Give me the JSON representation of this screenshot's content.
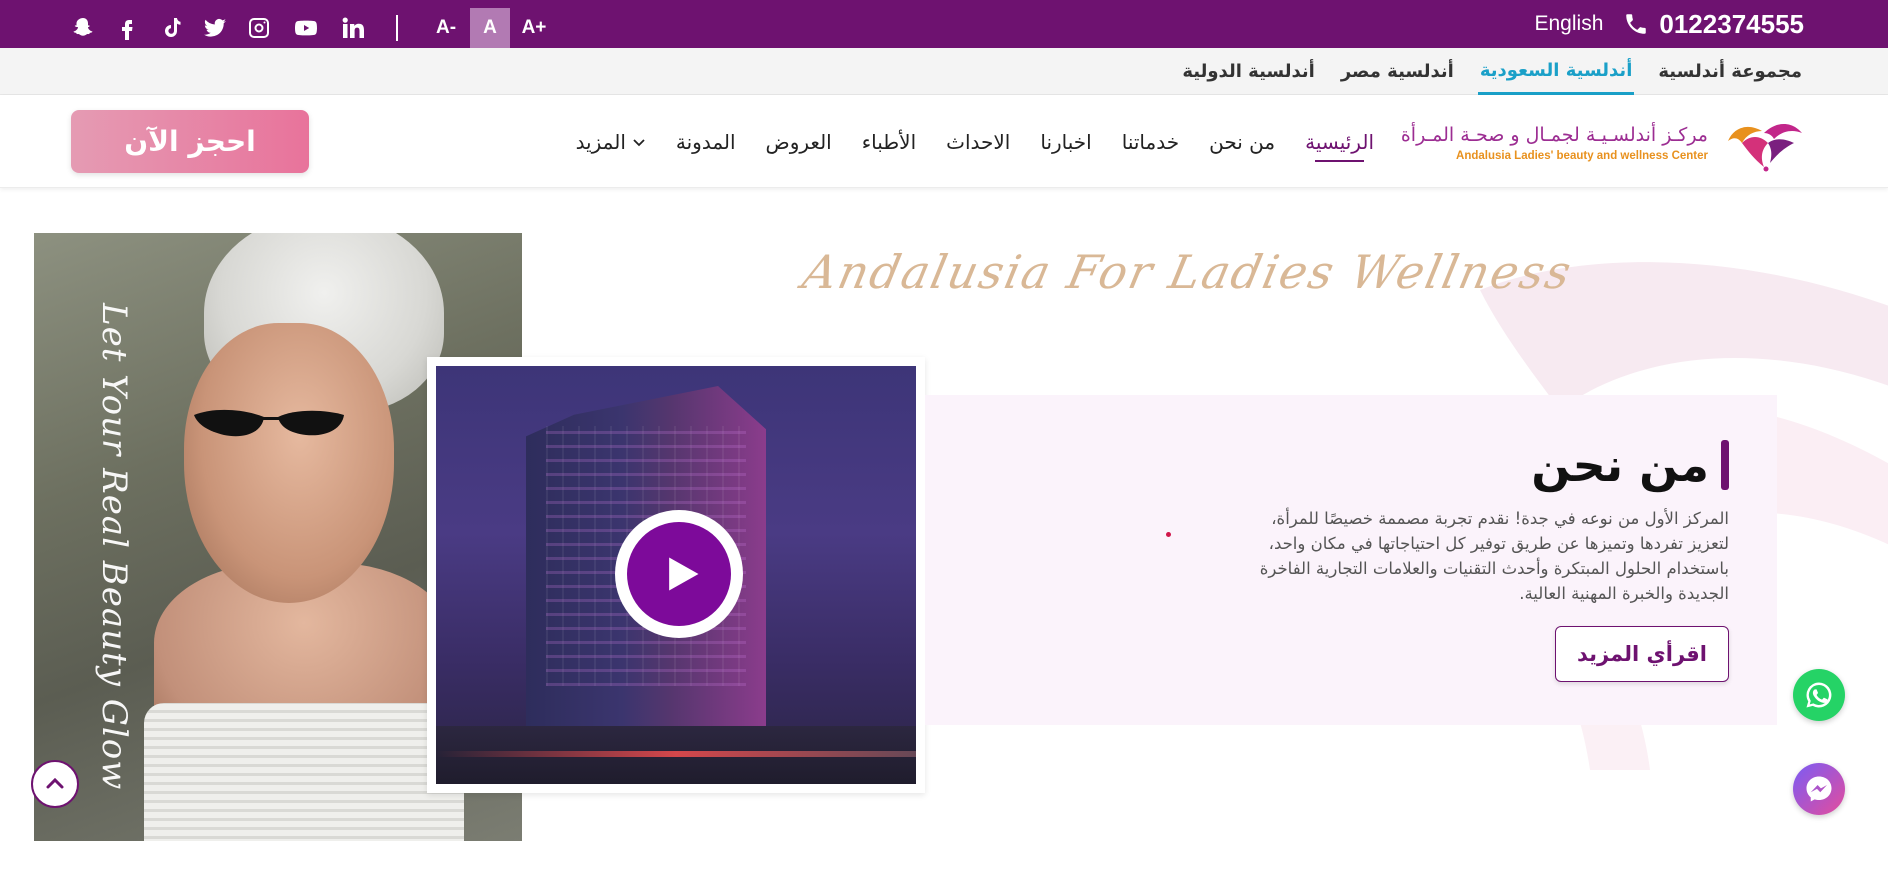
{
  "topbar": {
    "social": [
      "snapchat-icon",
      "facebook-icon",
      "tiktok-icon",
      "twitter-icon",
      "instagram-icon",
      "youtube-icon",
      "linkedin-icon"
    ],
    "font_controls": {
      "decrease": "A-",
      "normal": "A",
      "increase": "A+"
    },
    "language": "English",
    "phone": "0122374555",
    "bg_color": "#6e1270"
  },
  "group_bar": {
    "links": [
      {
        "label": "مجموعة أندلسية",
        "active": false
      },
      {
        "label": "أندلسية السعودية",
        "active": true
      },
      {
        "label": "أندلسية مصر",
        "active": false
      },
      {
        "label": "أندلسية الدولية",
        "active": false
      }
    ]
  },
  "logo": {
    "arabic": "مركـز أندلسـيـة لجمـال و صحـة المـرأة",
    "english": "Andalusia Ladies' beauty and wellness Center"
  },
  "nav": {
    "items": [
      {
        "label": "الرئيسية",
        "active": true
      },
      {
        "label": "من نحن"
      },
      {
        "label": "خدماتنا"
      },
      {
        "label": "اخبارنا"
      },
      {
        "label": "الاحداث"
      },
      {
        "label": "الأطباء"
      },
      {
        "label": "العروض"
      },
      {
        "label": "المدونة"
      },
      {
        "label": "المزيد"
      }
    ],
    "book_button": "احجز الآن"
  },
  "hero": {
    "script_title": "Andalusia For Ladies Wellness",
    "photo_script": "Let Your Real Beauty Glow"
  },
  "about": {
    "title": "من نحن",
    "text": "المركز الأول من نوعه في جدة! نقدم تجربة مصممة خصيصًا للمرأة، لتعزيز تفردها وتميزها عن طريق توفير كل احتياجاتها في مكان واحد، باستخدام الحلول المبتكرة وأحدث التقنيات والعلامات التجارية الفاخرة الجديدة والخبرة المهنية العالية.",
    "read_more": "اقرأي المزيد"
  },
  "colors": {
    "primary": "#6e1270",
    "accent_link": "#1aa0c8",
    "book_button": "#e8739b",
    "panel_bg": "#fbf3fb"
  }
}
